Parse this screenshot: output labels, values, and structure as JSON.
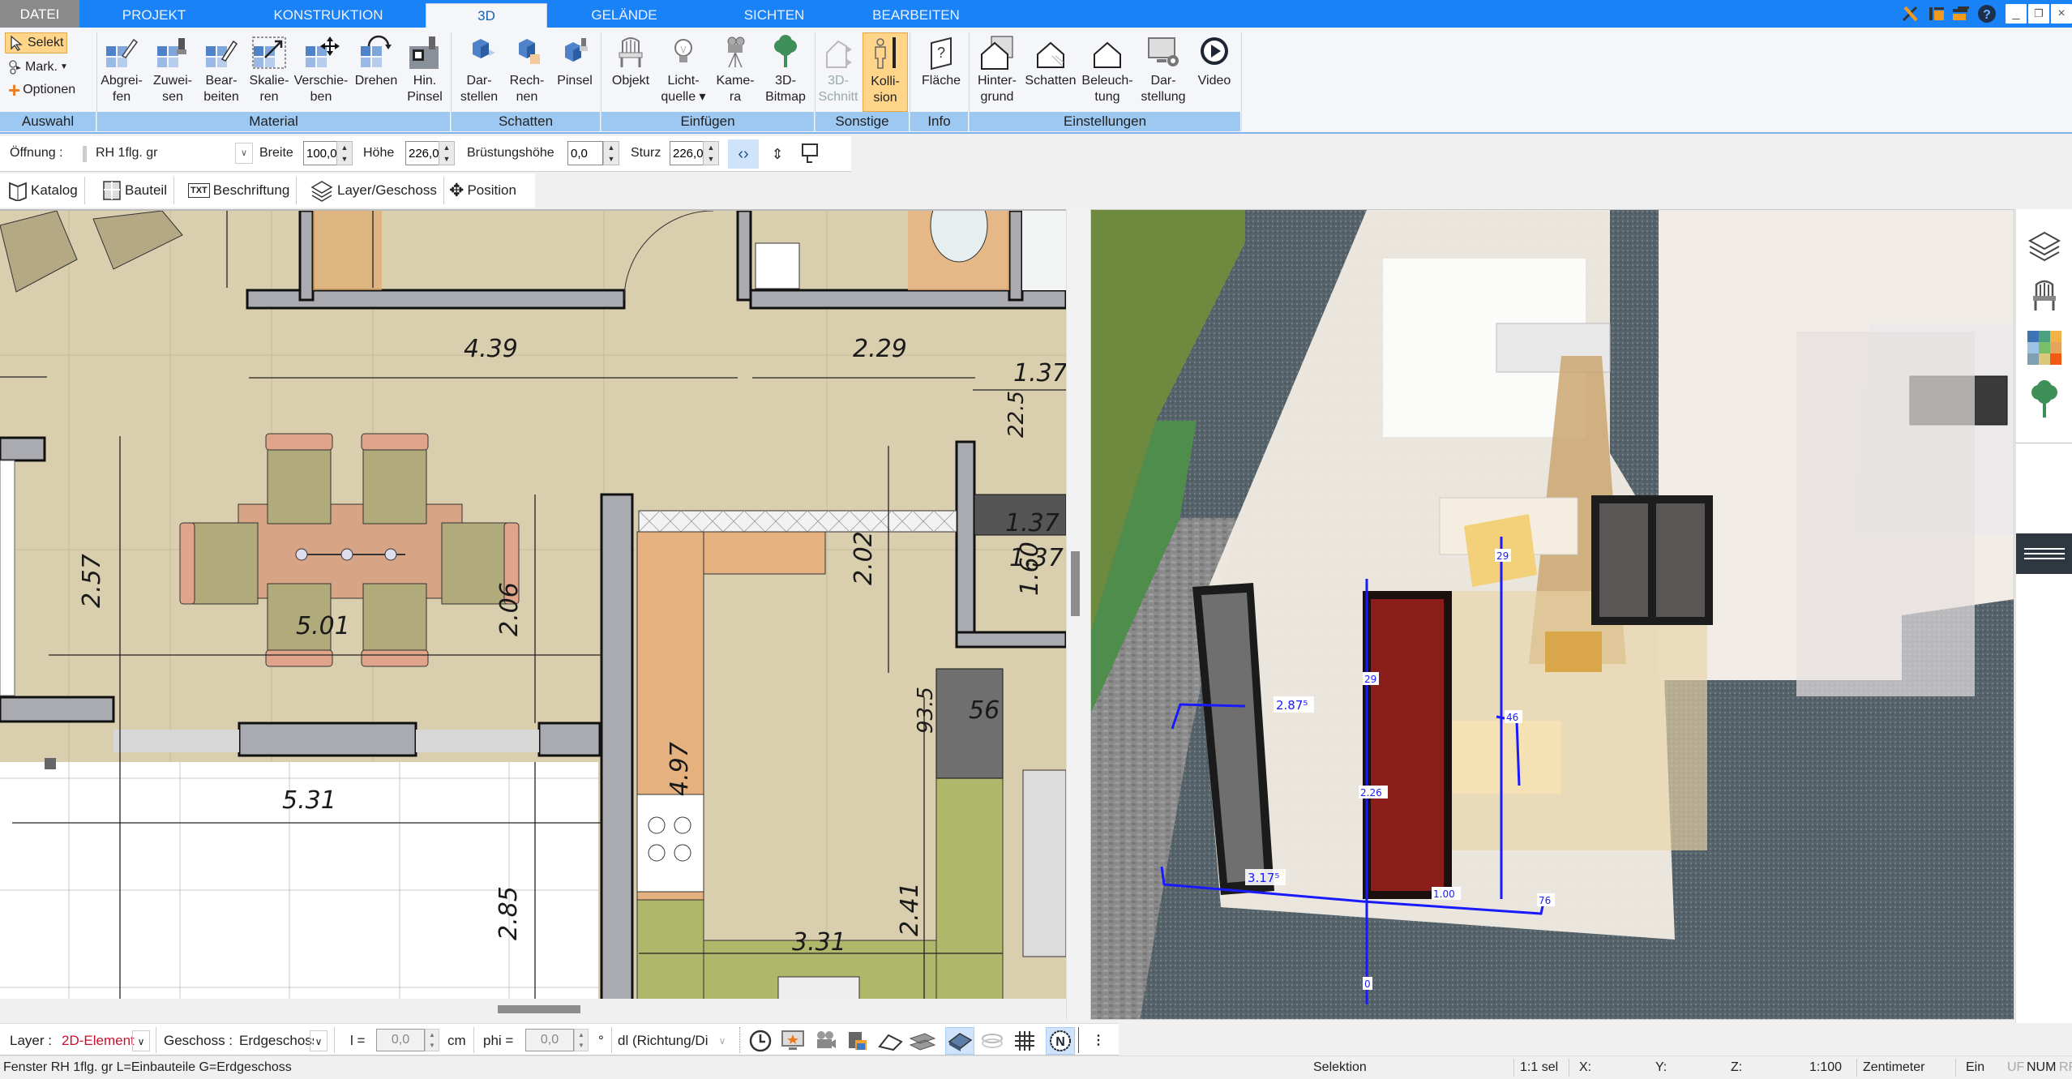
{
  "tabs": {
    "file": "DATEI",
    "items": [
      "PROJEKT",
      "KONSTRUKTION",
      "3D",
      "GELÄNDE",
      "SICHTEN",
      "BEARBEITEN"
    ],
    "active": "3D"
  },
  "ribbon": {
    "selection": {
      "select": "Selekt",
      "mark": "Mark.",
      "options": "Optionen"
    },
    "buttons": {
      "abgreifen": [
        "Abgrei-",
        "fen"
      ],
      "zuweisen": [
        "Zuwei-",
        "sen"
      ],
      "bearbeiten": [
        "Bear-",
        "beiten"
      ],
      "skalieren": [
        "Skalie-",
        "ren"
      ],
      "verschieben": [
        "Verschie-",
        "ben"
      ],
      "drehen": [
        "Drehen",
        ""
      ],
      "hin_pinsel": [
        "Hin.",
        "Pinsel"
      ],
      "darstellen": [
        "Dar-",
        "stellen"
      ],
      "rechnen": [
        "Rech-",
        "nen"
      ],
      "pinsel": [
        "Pinsel",
        ""
      ],
      "objekt": [
        "Objekt",
        ""
      ],
      "lichtquelle": [
        "Licht-",
        "quelle ▾"
      ],
      "kamera": [
        "Kame-",
        "ra"
      ],
      "bitmap": [
        "3D-",
        "Bitmap"
      ],
      "schnitt": [
        "3D-",
        "Schnitt"
      ],
      "kollision": [
        "Kolli-",
        "sion"
      ],
      "flaeche": [
        "Fläche",
        ""
      ],
      "hintergrund": [
        "Hinter-",
        "grund"
      ],
      "schatten": [
        "Schatten",
        ""
      ],
      "beleuchtung": [
        "Beleuch-",
        "tung"
      ],
      "darstellung": [
        "Dar-",
        "stellung"
      ],
      "video": [
        "Video",
        ""
      ]
    },
    "groups": {
      "auswahl": "Auswahl",
      "material": "Material",
      "schatten": "Schatten",
      "einfuegen": "Einfügen",
      "sonstige": "Sonstige",
      "info": "Info",
      "einstellungen": "Einstellungen"
    }
  },
  "options_bar": {
    "opening_label": "Öffnung :",
    "opening_value": "RH 1flg. gr",
    "width_label": "Breite",
    "width_value": "100,0",
    "height_label": "Höhe",
    "height_value": "226,0",
    "sill_label": "Brüstungshöhe",
    "sill_value": "0,0",
    "lintel_label": "Sturz",
    "lintel_value": "226,0"
  },
  "toolbar2": {
    "katalog": "Katalog",
    "bauteil": "Bauteil",
    "beschriftung": "Beschriftung",
    "layer": "Layer/Geschoss",
    "position": "Position"
  },
  "floorplan": {
    "dimensions": {
      "d439": "4.39",
      "d229": "2.29",
      "d137a": "1.37",
      "d137b": "1.37",
      "d137c": "1.37",
      "d225": "22.5",
      "d257": "2.57",
      "d501": "5.01",
      "d206": "2.06",
      "d202": "2.02",
      "d160": "1.60",
      "d56": "56",
      "d935": "93.5",
      "d497": "4.97",
      "d531": "5.31",
      "d285": "2.85",
      "d241": "2.41",
      "d331": "3.31"
    }
  },
  "view3d": {
    "labels": {
      "l3175": "3.17⁵",
      "l2875": "2.87⁵",
      "l29a": "29",
      "l29b": "29",
      "l226": "2.26",
      "l100": "1.00",
      "l76": "76",
      "l46": "46",
      "l0": "0"
    }
  },
  "bottom_bar": {
    "layer_label": "Layer :",
    "layer_value": "2D-Element",
    "floor_label": "Geschoss :",
    "floor_value": "Erdgeschoss",
    "l_label": "l =",
    "l_value": "0,0",
    "l_unit": "cm",
    "phi_label": "phi =",
    "phi_value": "0,0",
    "phi_unit": "°",
    "dir_value": "dl (Richtung/Di"
  },
  "status": {
    "message": "Fenster RH 1flg. gr L=Einbauteile G=Erdgeschoss",
    "mode": "Selektion",
    "sel": "1:1 sel",
    "x": "X:",
    "y": "Y:",
    "z": "Z:",
    "scale": "1:100",
    "unit": "Zentimeter",
    "ein": "Ein",
    "uf": "UF",
    "num": "NUM",
    "rf": "RF"
  },
  "colors": {
    "accent": "#1a82f7",
    "ribbon_group": "#9cc8f2",
    "active_toggle": "#ffd58a",
    "dimension_3d": "#1a1aff",
    "selected_door": "#8b1e1a"
  }
}
